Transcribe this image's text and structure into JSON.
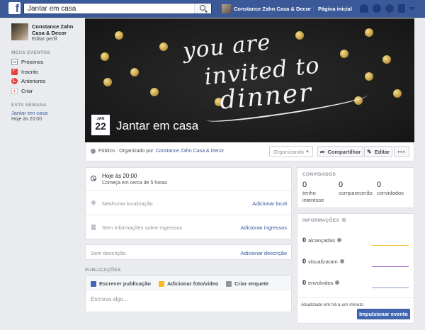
{
  "topbar": {
    "logo_letter": "f",
    "search_value": "Jantar em casa",
    "user_name": "Constance Zahn Casa & Decor",
    "home_label": "Página inicial",
    "icons": [
      "friends-icon",
      "messages-icon",
      "notifications-icon",
      "privacy-icon",
      "account-menu-icon"
    ]
  },
  "sidebar": {
    "profile_name": "Constance Zahn Casa & Decor",
    "edit_profile": "Editar perfil",
    "section_my_events": "MEUS EVENTOS",
    "items": [
      {
        "label": "Próximos",
        "icon_text": "22"
      },
      {
        "label": "Inscrito"
      },
      {
        "label": "Anteriores"
      },
      {
        "label": "Criar"
      }
    ],
    "section_this_week": "ESTA SEMANA",
    "week_event": "Jantar em casa",
    "week_time": "Hoje às 20:00"
  },
  "cover": {
    "line1": "you are",
    "line2": "invited to",
    "line3": "dinner",
    "date_month": "JAN",
    "date_day": "22",
    "event_title": "Jantar em casa",
    "dot_color": "#c9a34a"
  },
  "info_bar": {
    "privacy_text": "Público · Organizado por",
    "organizer": "Constance Zahn Casa & Decor",
    "organizing_label": "Organizando",
    "share_label": "Compartilhar",
    "edit_label": "Editar",
    "more_label": "•••"
  },
  "details": {
    "time_main": "Hoje às 20:00",
    "time_sub": "Começa em cerca de 5 horas",
    "location_text": "Nenhuma localização",
    "location_link": "Adicionar local",
    "tickets_text": "Sem informações sobre ingressos",
    "tickets_link": "Adicionar ingressos"
  },
  "description": {
    "text": "Sem descrição",
    "link": "Adicionar descrição"
  },
  "publications": {
    "header": "PUBLICAÇÕES",
    "tab_write": "Escrever publicação",
    "tab_photo": "Adicionar foto/vídeo",
    "tab_poll": "Criar enquete",
    "placeholder": "Escreva algo..."
  },
  "guests": {
    "header": "CONVIDADOS",
    "items": [
      {
        "count": "0",
        "label": "tenho interesse"
      },
      {
        "count": "0",
        "label": "comparecerão"
      },
      {
        "count": "0",
        "label": "convidados"
      }
    ]
  },
  "stats": {
    "header": "INFORMAÇÕES",
    "rows": [
      {
        "count": "0",
        "label": "alcançadas",
        "color": "#f7b928"
      },
      {
        "count": "0",
        "label": "visualizaram",
        "color": "#a36ecb"
      },
      {
        "count": "0",
        "label": "envolvidos",
        "color": "#8b9dc3"
      }
    ],
    "updated": "Atualizado em há a um minuto",
    "boost_label": "Impulsionar evento"
  }
}
